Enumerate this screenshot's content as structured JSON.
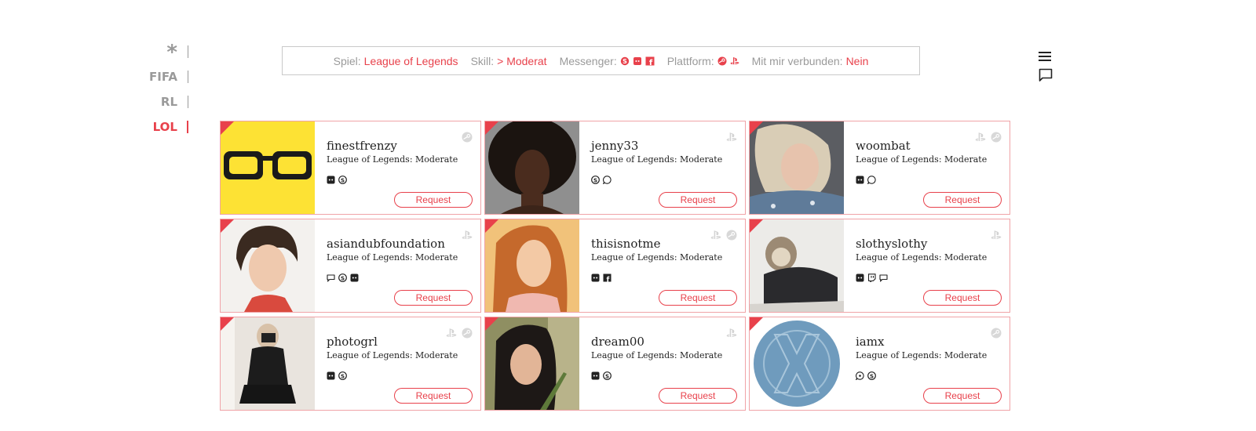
{
  "game_nav": [
    {
      "label": "*",
      "active": false
    },
    {
      "label": "FIFA",
      "active": false
    },
    {
      "label": "RL",
      "active": false
    },
    {
      "label": "LOL",
      "active": true
    }
  ],
  "filter": {
    "spiel_label": "Spiel:",
    "spiel_value": "League of Legends",
    "skill_label": "Skill:",
    "skill_value": "> Moderat",
    "messenger_label": "Messenger:",
    "messenger_icons": [
      "skype-icon",
      "discord-icon",
      "facebook-icon"
    ],
    "plattform_label": "Plattform:",
    "plattform_icons": [
      "steam-icon",
      "playstation-icon"
    ],
    "verbunden_label": "Mit mir verbunden:",
    "verbunden_value": "Nein"
  },
  "colors": {
    "accent": "#e8414b",
    "border": "#f0a3a7",
    "muted": "#9a9a9a"
  },
  "cards": [
    {
      "name": "finestfrenzy",
      "game": "League of Legends: Moderate",
      "messengers": [
        "discord",
        "skype"
      ],
      "platforms": [
        "steam"
      ],
      "button": "Request",
      "avatar": "glasses"
    },
    {
      "name": "jenny33",
      "game": "League of Legends: Moderate",
      "messengers": [
        "skype",
        "whatsapp"
      ],
      "platforms": [
        "playstation"
      ],
      "button": "Request",
      "avatar": "curly-hair"
    },
    {
      "name": "woombat",
      "game": "League of Legends: Moderate",
      "messengers": [
        "discord",
        "whatsapp"
      ],
      "platforms": [
        "playstation",
        "steam"
      ],
      "button": "Request",
      "avatar": "blonde"
    },
    {
      "name": "asiandubfoundation",
      "game": "League of Legends: Moderate",
      "messengers": [
        "chat",
        "skype",
        "discord"
      ],
      "platforms": [
        "playstation"
      ],
      "button": "Request",
      "avatar": "short-hair"
    },
    {
      "name": "thisisnotme",
      "game": "League of Legends: Moderate",
      "messengers": [
        "discord",
        "facebook"
      ],
      "platforms": [
        "playstation",
        "steam"
      ],
      "button": "Request",
      "avatar": "redhead"
    },
    {
      "name": "slothyslothy",
      "game": "League of Legends: Moderate",
      "messengers": [
        "discord",
        "twitch",
        "chat"
      ],
      "platforms": [
        "playstation"
      ],
      "button": "Request",
      "avatar": "sloth"
    },
    {
      "name": "photogrl",
      "game": "League of Legends: Moderate",
      "messengers": [
        "discord",
        "skype"
      ],
      "platforms": [
        "playstation",
        "steam"
      ],
      "button": "Request",
      "avatar": "photographer"
    },
    {
      "name": "dream00",
      "game": "League of Legends: Moderate",
      "messengers": [
        "discord",
        "skype"
      ],
      "platforms": [
        "playstation"
      ],
      "button": "Request",
      "avatar": "dark-hair"
    },
    {
      "name": "iamx",
      "game": "League of Legends: Moderate",
      "messengers": [
        "viber",
        "skype"
      ],
      "platforms": [
        "steam"
      ],
      "button": "Request",
      "avatar": "x-logo"
    }
  ]
}
